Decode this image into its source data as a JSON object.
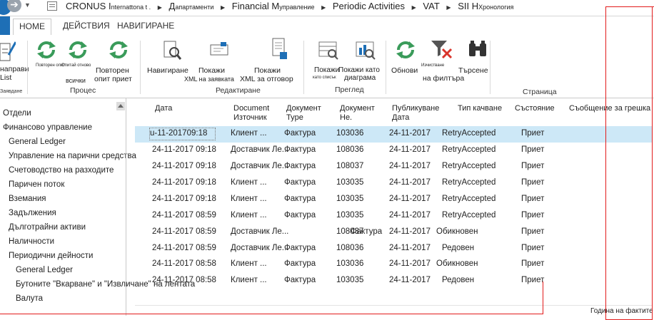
{
  "addressbar": {
    "company_big": "CRONUS I",
    "company_small": "nternattona t .",
    "crumb1_big": "Д",
    "crumb1_small": "апартаменти",
    "crumb2_big": "Financial M",
    "crumb2_small": "управление",
    "crumb3": "Periodic Activities",
    "crumb4": "VAT",
    "crumb5_big": "SII H",
    "crumb5_small": "Хронология"
  },
  "tabs": [
    "HOME",
    "ДЕЙСТВИЯ",
    "НАВИГИРАНЕ"
  ],
  "ribbon": {
    "new_label_1": "направи",
    "new_label_2": "List",
    "new_group_label": "Заявдане",
    "retry_small": "Повторен опит",
    "retry_all_small": "Опитай отново",
    "retry_all_label": "всички",
    "retry_request_label_1": "Повторен",
    "retry_request_label_2": "опит приет",
    "group_process": "Процес",
    "navigate_label": "Навигиране",
    "show_request_label_1": "Покажи",
    "show_request_label_2": "XML на заявката",
    "show_response_label_1": "Покажи",
    "show_response_label_2": "XML за отговор",
    "group_edit": "Редактиране",
    "show_list_label_1": "Покажи",
    "show_list_label_2": "като списък",
    "show_chart_label_1": "Покажи като",
    "show_chart_label_2": "диаграма",
    "group_view": "Преглед",
    "refresh_label": "Обнови",
    "clear_filter_small": "Изчистване",
    "clear_filter_label": "на филтъра",
    "find_label": "Търсене",
    "group_page": "Страница"
  },
  "leftnav": [
    "Отдели",
    "Финансово управление",
    "General Ledger",
    "Управление на парични средства",
    "Счетоводство на разходите",
    "Паричен поток",
    "Вземания",
    "Задължения",
    "Дълготрайни активи",
    "Наличности",
    "Периодични дейности",
    "General Ledger",
    "Бутоните \"Вкарване\" и \"Извличане\" на лентата",
    "Валута"
  ],
  "columns": {
    "date": "Дата",
    "doc_source_1": "Document",
    "doc_source_2": "Източник",
    "doc_type_1": "Документ",
    "doc_type_2": "Type",
    "doc_no_1": "Документ",
    "doc_no_2": "Не.",
    "posting_1": "Публикуване",
    "posting_2": "Дата",
    "upload_type": "Тип качване",
    "state": "Състояние",
    "error": "Съобщение за грешка"
  },
  "rows": [
    {
      "date": "u-11-201709:18",
      "source": "Клиент ...",
      "type": "Фактура",
      "no": "103036",
      "posting": "24-11-2017",
      "upload": "RetryAccepted",
      "state": "Приет"
    },
    {
      "date": "24-11-2017 09:18",
      "source": "Доставчик Ле...",
      "type": "Фактура",
      "no": "108036",
      "posting": "24-11-2017",
      "upload": "RetryAccepted",
      "state": "Приет"
    },
    {
      "date": "24-11-2017 09:18",
      "source": "Доставчик Ле...",
      "type": "Фактура",
      "no": "108037",
      "posting": "24-11-2017",
      "upload": "RetryAccepted",
      "state": "Приет"
    },
    {
      "date": "24-11-2017 09:18",
      "source": "Клиент ...",
      "type": "Фактура",
      "no": "103035",
      "posting": "24-11-2017",
      "upload": "RetryAccepted",
      "state": "Приет"
    },
    {
      "date": "24-11-2017 09:18",
      "source": "Клиент ...",
      "type": "Фактура",
      "no": "103035",
      "posting": "24-11-2017",
      "upload": "RetryAccepted",
      "state": "Приет"
    },
    {
      "date": "24-11-2017 08:59",
      "source": "Клиент ...",
      "type": "Фактура",
      "no": "103035",
      "posting": "24-11-2017",
      "upload": "RetryAccepted",
      "state": "Приет"
    },
    {
      "date": "24-11-2017 08:59",
      "source": "Доставчик Ле...",
      "type": "",
      "no": "108037",
      "no_overlay": "Фактура",
      "posting": "24-11-2017",
      "upload": "Обикновен",
      "state": "Приет"
    },
    {
      "date": "24-11-2017 08:59",
      "source": "Доставчик Ле...",
      "type": "Фактура",
      "no": "108036",
      "posting": "24-11-2017",
      "upload": "Редовен",
      "state": "Приет"
    },
    {
      "date": "24-11-2017 08:58",
      "source": "Клиент ...",
      "type": "Фактура",
      "no": "103036",
      "posting": "24-11-2017",
      "upload": "Обикновен",
      "state": "Приет"
    },
    {
      "date": "24-11-2017 08:58",
      "source": "Клиент ...",
      "type": "Фактура",
      "no": "103035",
      "posting": "24-11-2017",
      "upload": "Редовен",
      "state": "Приет"
    }
  ],
  "status_text": "Година на фактите",
  "colors": {
    "accent": "#1e6fb6",
    "selected_row": "#cde8f7",
    "highlight_border": "#e21b1b",
    "icon_green": "#3a9b5a"
  }
}
